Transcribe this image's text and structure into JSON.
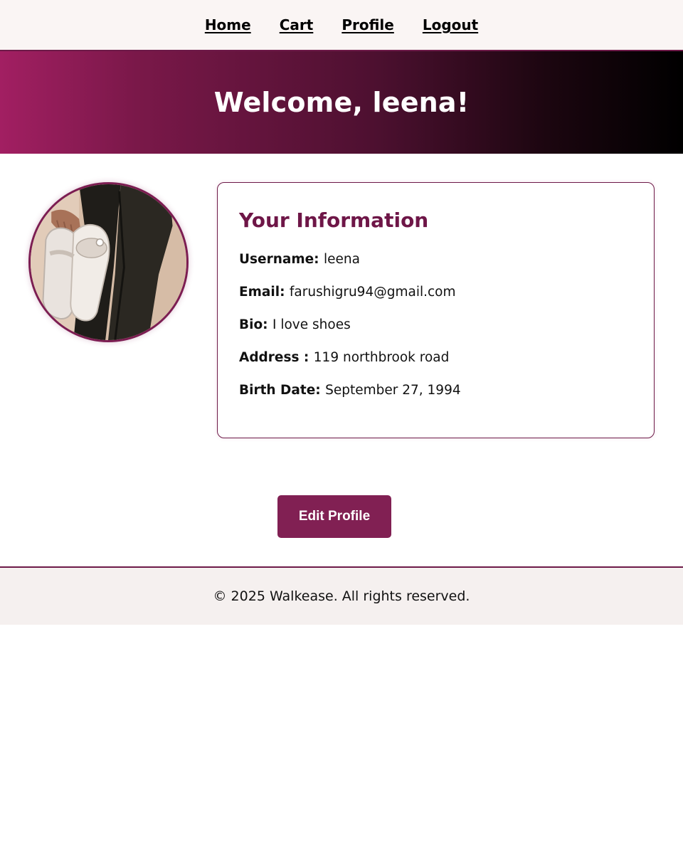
{
  "nav": {
    "links": [
      {
        "label": "Home"
      },
      {
        "label": "Cart"
      },
      {
        "label": "Profile"
      },
      {
        "label": "Logout"
      }
    ]
  },
  "hero": {
    "title": "Welcome, leena!"
  },
  "profile": {
    "avatar_icon": "user-photo-holding-sandals",
    "card_title": "Your Information",
    "fields": [
      {
        "label": "Username:",
        "value": "leena"
      },
      {
        "label": "Email:",
        "value": "farushigru94@gmail.com"
      },
      {
        "label": "Bio:",
        "value": "I love shoes"
      },
      {
        "label": "Address :",
        "value": "119 northbrook road"
      },
      {
        "label": "Birth Date:",
        "value": "September 27, 1994"
      }
    ],
    "edit_label": "Edit Profile"
  },
  "footer": {
    "text": "© 2025 Walkease. All rights reserved."
  },
  "colors": {
    "accent": "#812053",
    "heading": "#6e1647",
    "gradient_start": "#a21f62",
    "gradient_end": "#000000"
  }
}
